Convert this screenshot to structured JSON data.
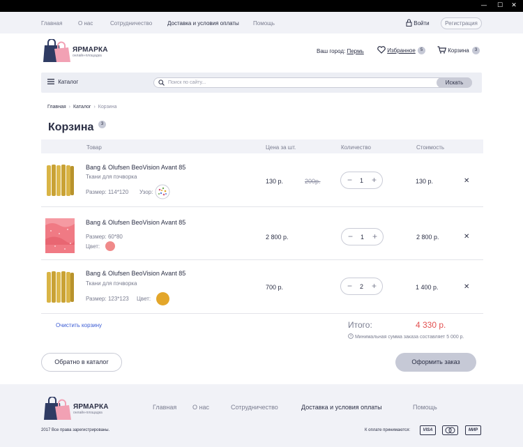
{
  "window": {
    "minimize_icon": "minimize-icon",
    "maximize_icon": "maximize-icon",
    "close_icon": "close-icon"
  },
  "top_nav": {
    "items": [
      {
        "label": "Главная",
        "active": false
      },
      {
        "label": "О нас",
        "active": false
      },
      {
        "label": "Сотрудничество",
        "active": false
      },
      {
        "label": "Доставка и условия оплаты",
        "active": true
      },
      {
        "label": "Помощь",
        "active": false
      }
    ],
    "login_label": "Войти",
    "register_label": "Регистрация"
  },
  "header": {
    "logo_title": "ЯРМАРКА",
    "logo_subtitle": "онлайн-площадка",
    "city_label": "Ваш город:",
    "city_value": "Пермь",
    "favorites_label": "Избранное",
    "favorites_count": "5",
    "cart_label": "Корзина",
    "cart_count": "3"
  },
  "search": {
    "catalog_label": "Каталог",
    "placeholder": "Поиск по сайту...",
    "button_label": "Искать"
  },
  "breadcrumb": [
    "Главная",
    "Каталог",
    "Корзина"
  ],
  "page": {
    "title": "Корзина",
    "count": "3"
  },
  "table": {
    "headers": [
      "Товар",
      "Цена за шт.",
      "Количество",
      "Стоимость"
    ],
    "rows": [
      {
        "name": "Bang & Olufsen BeoVision Avant 85",
        "type": "Ткани для пэчворка",
        "size": "Размер: 114*120",
        "attr_label": "Узор:",
        "price": "130 р.",
        "old_price": "200р.",
        "qty": "1",
        "cost": "130 р."
      },
      {
        "name": "Bang & Olufsen BeoVision Avant 85",
        "type": "",
        "size": "Размер: 60*80",
        "attr_label": "Цвет:",
        "price": "2 800 р.",
        "old_price": "",
        "qty": "1",
        "cost": "2 800 р.",
        "swatch_color": "#f08a8a"
      },
      {
        "name": "Bang & Olufsen BeoVision Avant 85",
        "type": "Ткани для пэчворка",
        "size": "Размер: 123*123",
        "attr_label": "Цвет:",
        "price": "700 р.",
        "old_price": "",
        "qty": "2",
        "cost": "1 400 р.",
        "swatch_color": "#e3a62a"
      }
    ]
  },
  "summary": {
    "clear_label": "Очистить корзину",
    "total_label": "Итого:",
    "total_value": "4 330 р.",
    "min_sum_note": "Минимальная сумма заказа составляет 5 000 р."
  },
  "actions": {
    "back_label": "Обратно в каталог",
    "order_label": "Оформить заказ"
  },
  "footer": {
    "logo_title": "ЯРМАРКА",
    "logo_subtitle": "онлайн-площадка",
    "nav": [
      {
        "label": "Главная",
        "active": false
      },
      {
        "label": "О нас",
        "active": false
      },
      {
        "label": "Сотрудничество",
        "active": false
      },
      {
        "label": "Доставка и условия оплаты",
        "active": true
      },
      {
        "label": "Помощь",
        "active": false
      }
    ],
    "copyright": "2017 Все права зарегистрированы.",
    "payment_label": "К оплате принимаются:",
    "payment_cards": [
      "VISA",
      "MasterCard",
      "МИР"
    ]
  },
  "colors": {
    "accent_red": "#e24f4f",
    "link_blue": "#3a5bd4",
    "bg_light": "#f1f2f7"
  }
}
